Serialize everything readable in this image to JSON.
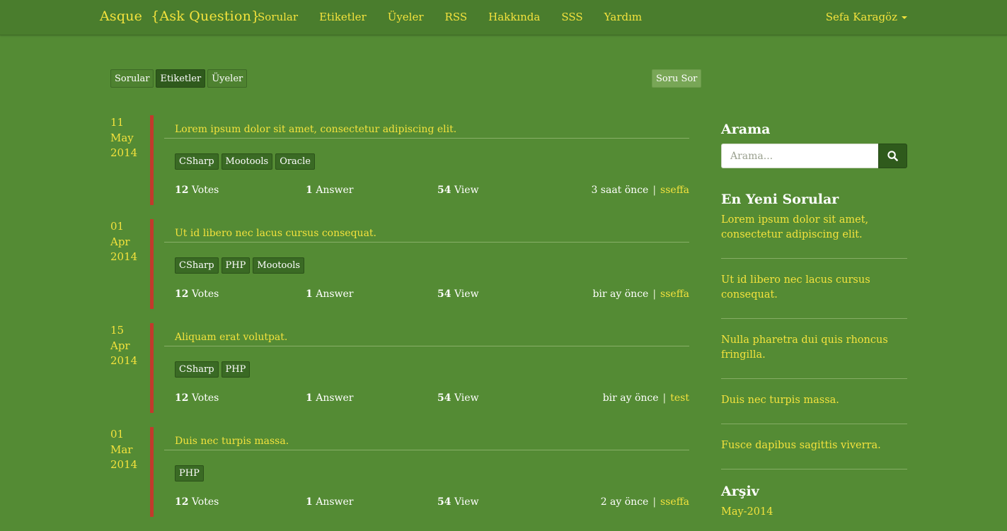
{
  "navbar": {
    "brand": "Asque",
    "tagline": "{Ask Question}",
    "links": [
      "Sorular",
      "Etiketler",
      "Üyeler",
      "RSS",
      "Hakkında",
      "SSS",
      "Yardım"
    ],
    "user": "Sefa Karagöz"
  },
  "toolbar": {
    "tabs": [
      "Sorular",
      "Etiketler",
      "Üyeler"
    ],
    "active_tab": "Etiketler",
    "ask_label": "Soru Sor"
  },
  "questions": [
    {
      "date": {
        "day": "11",
        "month": "May",
        "year": "2014"
      },
      "title": "Lorem ipsum dolor sit amet, consectetur adipiscing elit.",
      "tags": [
        "CSharp",
        "Mootools",
        "Oracle"
      ],
      "votes": "12",
      "votes_label": "Votes",
      "answers": "1",
      "answers_label": "Answer",
      "views": "54",
      "views_label": "View",
      "time": "3 saat önce",
      "separator": "|",
      "author": "sseffa"
    },
    {
      "date": {
        "day": "01",
        "month": "Apr",
        "year": "2014"
      },
      "title": "Ut id libero nec lacus cursus consequat.",
      "tags": [
        "CSharp",
        "PHP",
        "Mootools"
      ],
      "votes": "12",
      "votes_label": "Votes",
      "answers": "1",
      "answers_label": "Answer",
      "views": "54",
      "views_label": "View",
      "time": "bir ay önce",
      "separator": "|",
      "author": "sseffa"
    },
    {
      "date": {
        "day": "15",
        "month": "Apr",
        "year": "2014"
      },
      "title": "Aliquam erat volutpat.",
      "tags": [
        "CSharp",
        "PHP"
      ],
      "votes": "12",
      "votes_label": "Votes",
      "answers": "1",
      "answers_label": "Answer",
      "views": "54",
      "views_label": "View",
      "time": "bir ay önce",
      "separator": "|",
      "author": "test"
    },
    {
      "date": {
        "day": "01",
        "month": "Mar",
        "year": "2014"
      },
      "title": "Duis nec turpis massa.",
      "tags": [
        "PHP"
      ],
      "votes": "12",
      "votes_label": "Votes",
      "answers": "1",
      "answers_label": "Answer",
      "views": "54",
      "views_label": "View",
      "time": "2 ay önce",
      "separator": "|",
      "author": "sseffa"
    }
  ],
  "sidebar": {
    "search_heading": "Arama",
    "search_placeholder": "Arama...",
    "search_icon": "search-icon",
    "recent_heading": "En Yeni Sorular",
    "recent": [
      "Lorem ipsum dolor sit amet, consectetur adipiscing elit.",
      "Ut id libero nec lacus cursus consequat.",
      "Nulla pharetra dui quis rhoncus fringilla.",
      "Duis nec turpis massa.",
      "Fusce dapibus sagittis viverra."
    ],
    "archive_heading": "Arşiv",
    "archive": [
      "May-2014"
    ]
  },
  "colors": {
    "background": "#548b34",
    "navbar": "#4a7d2d",
    "accent": "#f3e23d",
    "bar": "#c23a2c",
    "tag": "#3a6a24"
  }
}
